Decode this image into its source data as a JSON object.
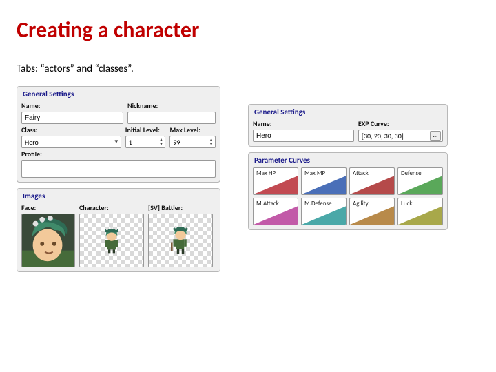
{
  "title": "Creating a character",
  "subtitle": "Tabs: “actors” and “classes”.",
  "actors": {
    "general_heading": "General Settings",
    "name_label": "Name:",
    "name_value": "Fairy",
    "nickname_label": "Nickname:",
    "nickname_value": "",
    "class_label": "Class:",
    "class_value": "Hero",
    "initial_level_label": "Initial Level:",
    "initial_level_value": "1",
    "max_level_label": "Max Level:",
    "max_level_value": "99",
    "profile_label": "Profile:",
    "profile_value": "",
    "images_heading": "Images",
    "face_label": "Face:",
    "character_label": "Character:",
    "sv_battler_label": "[SV] Battler:"
  },
  "classes": {
    "general_heading": "General Settings",
    "name_label": "Name:",
    "name_value": "Hero",
    "exp_curve_label": "EXP Curve:",
    "exp_curve_value": "[30, 20, 30, 30]",
    "exp_ellipsis": "...",
    "param_heading": "Parameter Curves",
    "params": [
      {
        "label": "Max HP",
        "color": "#C24A52"
      },
      {
        "label": "Max MP",
        "color": "#4A6FB8"
      },
      {
        "label": "Attack",
        "color": "#B54A4A"
      },
      {
        "label": "Defense",
        "color": "#5AA85A"
      },
      {
        "label": "M.Attack",
        "color": "#C25AA8"
      },
      {
        "label": "M.Defense",
        "color": "#4AA8A8"
      },
      {
        "label": "Agility",
        "color": "#B88A4A"
      },
      {
        "label": "Luck",
        "color": "#A8A84A"
      }
    ]
  }
}
